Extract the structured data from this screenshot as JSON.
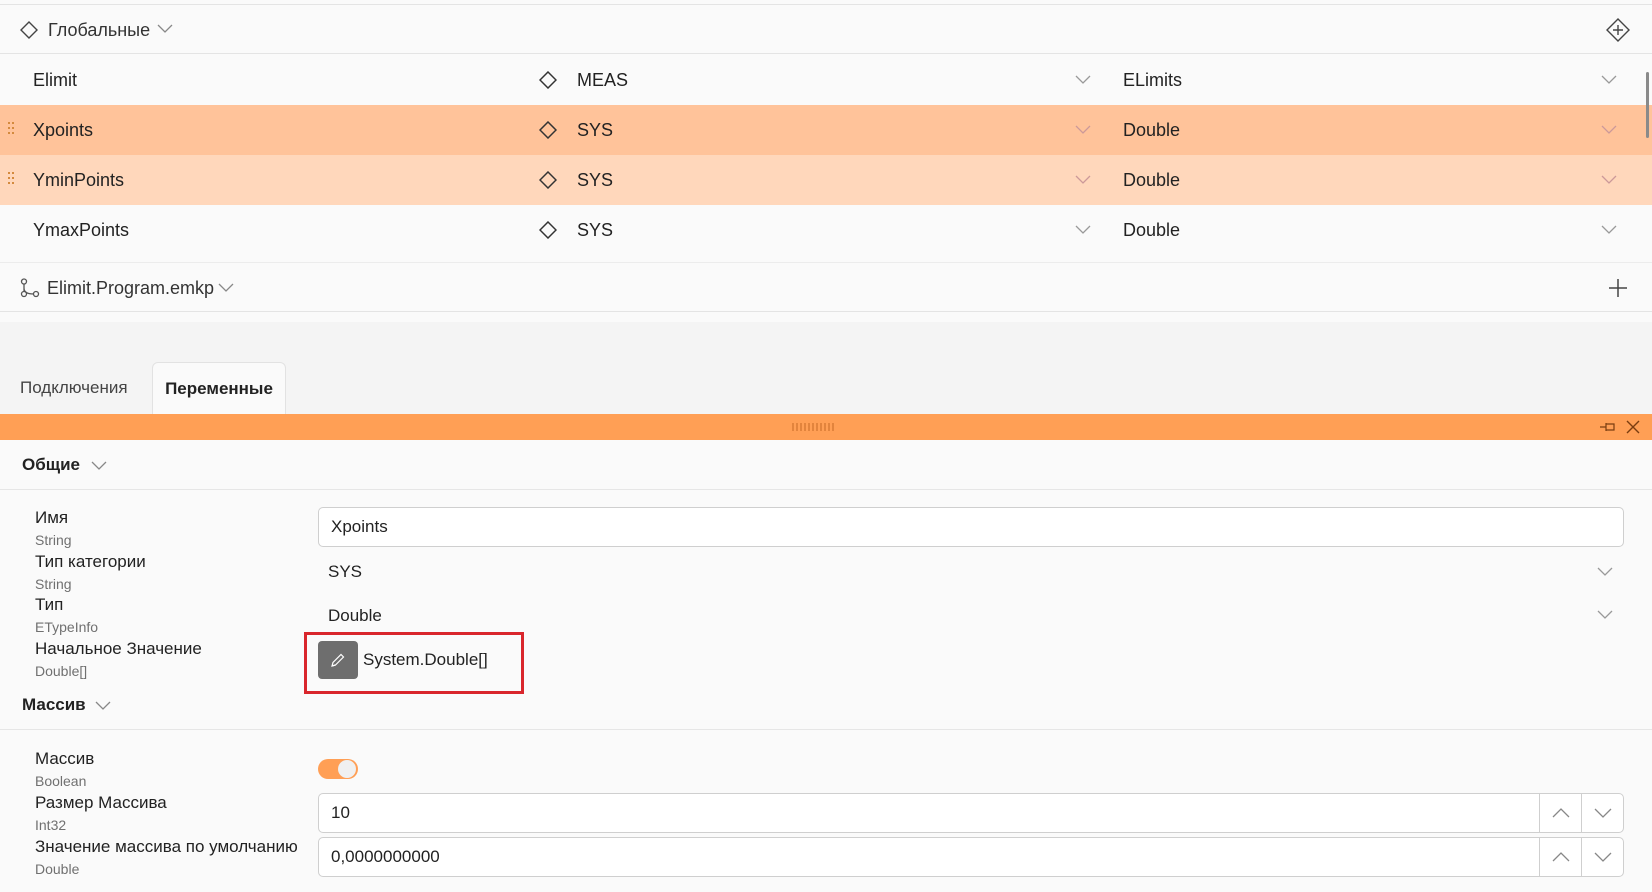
{
  "globals_group": {
    "title": "Глобальные"
  },
  "variables": [
    {
      "name": "Elimit",
      "category": "MEAS",
      "type": "ELimits",
      "selected": false
    },
    {
      "name": "Xpoints",
      "category": "SYS",
      "type": "Double",
      "selected": true
    },
    {
      "name": "YminPoints",
      "category": "SYS",
      "type": "Double",
      "selected": true
    },
    {
      "name": "YmaxPoints",
      "category": "SYS",
      "type": "Double",
      "selected": false
    }
  ],
  "program_group": {
    "title": "Elimit.Program.emkp"
  },
  "tabs": [
    {
      "label": "Подключения",
      "active": false
    },
    {
      "label": "Переменные",
      "active": true
    }
  ],
  "sections": {
    "general": {
      "title": "Общие",
      "props": [
        {
          "label": "Имя",
          "type": "String",
          "value": "Xpoints"
        },
        {
          "label": "Тип категории",
          "type": "String",
          "value": "SYS"
        },
        {
          "label": "Тип",
          "type": "ETypeInfo",
          "value": "Double"
        },
        {
          "label": "Начальное Значение",
          "type": "Double[]",
          "value": "System.Double[]"
        }
      ]
    },
    "array": {
      "title": "Массив",
      "props": [
        {
          "label": "Массив",
          "type": "Boolean",
          "value": true
        },
        {
          "label": "Размер Массива",
          "type": "Int32",
          "value": "10"
        },
        {
          "label": "Значение массива по умолчанию",
          "type": "Double",
          "value": "0,0000000000"
        }
      ]
    }
  },
  "colors": {
    "accent": "#ff9f55",
    "row_selected": "#ffc39a",
    "row_selected_light": "#ffd7bb",
    "highlight_box": "#d9262c"
  }
}
